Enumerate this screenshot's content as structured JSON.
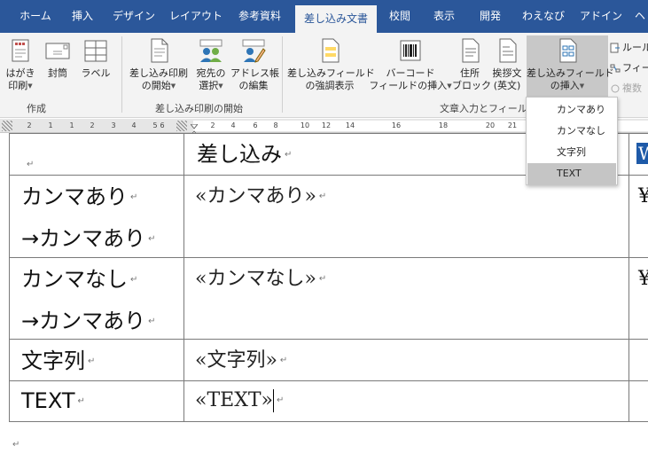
{
  "tabs": [
    {
      "label": "ホーム"
    },
    {
      "label": "挿入"
    },
    {
      "label": "デザイン"
    },
    {
      "label": "レイアウト"
    },
    {
      "label": "参考資料"
    },
    {
      "label": "差し込み文書",
      "active": true
    },
    {
      "label": "校閲"
    },
    {
      "label": "表示"
    },
    {
      "label": "開発"
    },
    {
      "label": "わえなび"
    },
    {
      "label": "アドイン"
    },
    {
      "label": "ヘ"
    }
  ],
  "ribbon": {
    "create": {
      "hagaki_l1": "はがき",
      "hagaki_l2": "印刷",
      "envelope": "封筒",
      "label": "ラベル",
      "group": "作成"
    },
    "start": {
      "start_l1": "差し込み印刷",
      "start_l2": "の開始",
      "select_l1": "宛先の",
      "select_l2": "選択",
      "edit_l1": "アドレス帳",
      "edit_l2": "の編集",
      "group": "差し込み印刷の開始"
    },
    "fields": {
      "highlight_l1": "差し込みフィールド",
      "highlight_l2": "の強調表示",
      "barcode_l1": "バーコード",
      "barcode_l2": "フィールドの挿入",
      "address_l1": "住所",
      "address_l2": "ブロック",
      "greeting_l1": "挨拶文",
      "greeting_l2": "(英文)",
      "insert_l1": "差し込みフィールド",
      "insert_l2": "の挿入",
      "group": "文章入力とフィールド",
      "rules": "ルール",
      "match": "フィー",
      "update": "複数"
    }
  },
  "ruler": {
    "left_marks": [
      "2",
      "1",
      "1",
      "2",
      "3",
      "4",
      "5",
      "6"
    ],
    "right_marks": [
      "2",
      "4",
      "6",
      "8",
      "10",
      "12",
      "14",
      "16",
      "18",
      "20",
      "21"
    ]
  },
  "document": {
    "rows": [
      {
        "label_lines": [],
        "field": "差し込み",
        "right_selected": "W"
      },
      {
        "label_lines": [
          "カンマあり",
          "→カンマあり"
        ],
        "field": "«カンマあり»",
        "right": "¥"
      },
      {
        "label_lines": [
          "カンマなし",
          "→カンマあり"
        ],
        "field": "«カンマなし»",
        "right": "¥"
      },
      {
        "label_lines": [
          "文字列"
        ],
        "field": "«文字列»",
        "right": ""
      },
      {
        "label_lines": [
          "TEXT"
        ],
        "field": "«TEXT»",
        "right": ""
      }
    ]
  },
  "dropdown": {
    "items": [
      {
        "label": "カンマあり"
      },
      {
        "label": "カンマなし"
      },
      {
        "label": "文字列"
      },
      {
        "label": "TEXT",
        "highlighted": true
      }
    ]
  },
  "marks": {
    "para": "↵"
  },
  "colors": {
    "ribbon_blue": "#2b579a",
    "selection": "#1e5aa8",
    "dropdown_hover": "#c5c5c5"
  }
}
